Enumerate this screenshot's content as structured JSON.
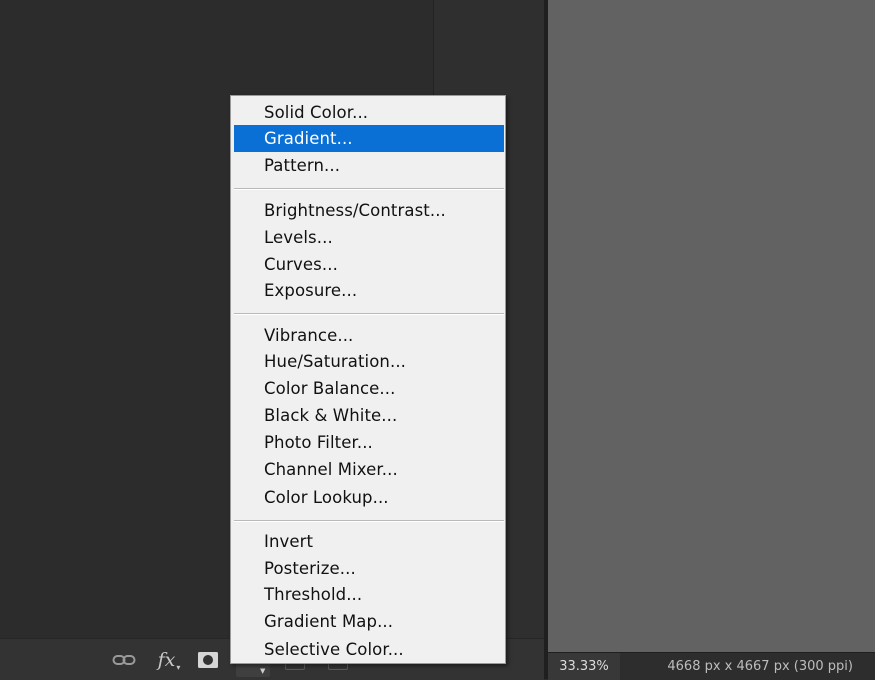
{
  "menu": {
    "groups": [
      {
        "items": [
          {
            "label": "Solid Color..."
          },
          {
            "label": "Gradient...",
            "highlighted": true
          },
          {
            "label": "Pattern..."
          }
        ]
      },
      {
        "items": [
          {
            "label": "Brightness/Contrast..."
          },
          {
            "label": "Levels..."
          },
          {
            "label": "Curves..."
          },
          {
            "label": "Exposure..."
          }
        ]
      },
      {
        "items": [
          {
            "label": "Vibrance..."
          },
          {
            "label": "Hue/Saturation..."
          },
          {
            "label": "Color Balance..."
          },
          {
            "label": "Black & White..."
          },
          {
            "label": "Photo Filter..."
          },
          {
            "label": "Channel Mixer..."
          },
          {
            "label": "Color Lookup..."
          }
        ]
      },
      {
        "items": [
          {
            "label": "Invert"
          },
          {
            "label": "Posterize..."
          },
          {
            "label": "Threshold..."
          },
          {
            "label": "Gradient Map..."
          },
          {
            "label": "Selective Color..."
          }
        ]
      }
    ],
    "highlight_color": "#0a70d6"
  },
  "layers_footer": {
    "icons": [
      "link-icon",
      "fx-icon",
      "mask-icon",
      "adjustment-layer-icon"
    ],
    "fx_label": "fx"
  },
  "status_bar": {
    "zoom": "33.33%",
    "document_info": "4668 px x 4667 px (300 ppi)"
  },
  "colors": {
    "canvas": "#626262",
    "menu_background": "#f0f0f0",
    "panel_background": "#2c2c2c"
  }
}
